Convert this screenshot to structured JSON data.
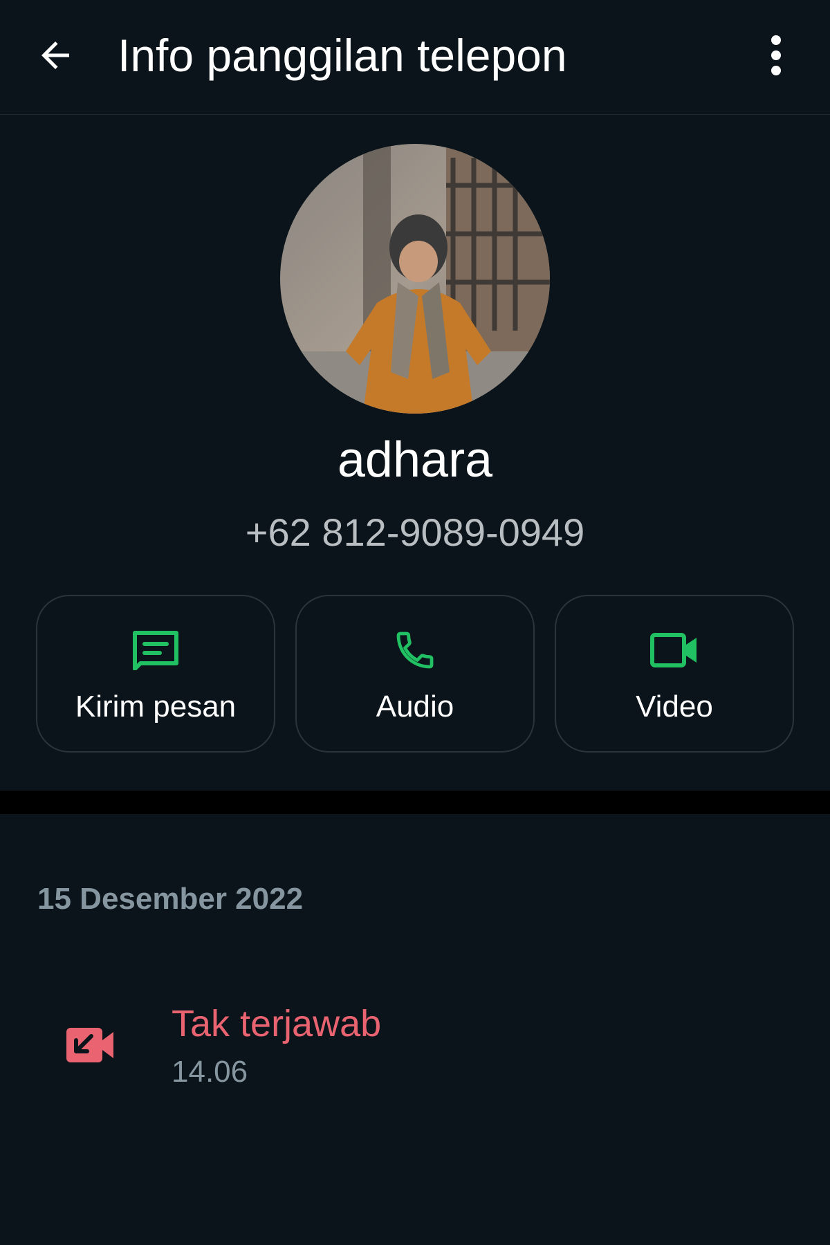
{
  "header": {
    "back_icon": "arrow-left-icon",
    "title": "Info panggilan telepon",
    "menu_icon": "more-vertical-icon"
  },
  "contact": {
    "avatar_description": "profile-photo",
    "name": "adhara",
    "phone": "+62 812-9089-0949"
  },
  "actions": [
    {
      "label": "Kirim pesan",
      "icon": "message-icon"
    },
    {
      "label": "Audio",
      "icon": "phone-icon"
    },
    {
      "label": "Video",
      "icon": "video-camera-icon"
    }
  ],
  "call_log": {
    "date": "15 Desember 2022",
    "calls": [
      {
        "status": "Tak terjawab",
        "time": "14.06",
        "icon": "missed-video-call-icon"
      }
    ]
  },
  "colors": {
    "background": "#0b141a",
    "accent_green": "#21c063",
    "missed_red": "#ea6370",
    "secondary_text": "#8696a0"
  }
}
